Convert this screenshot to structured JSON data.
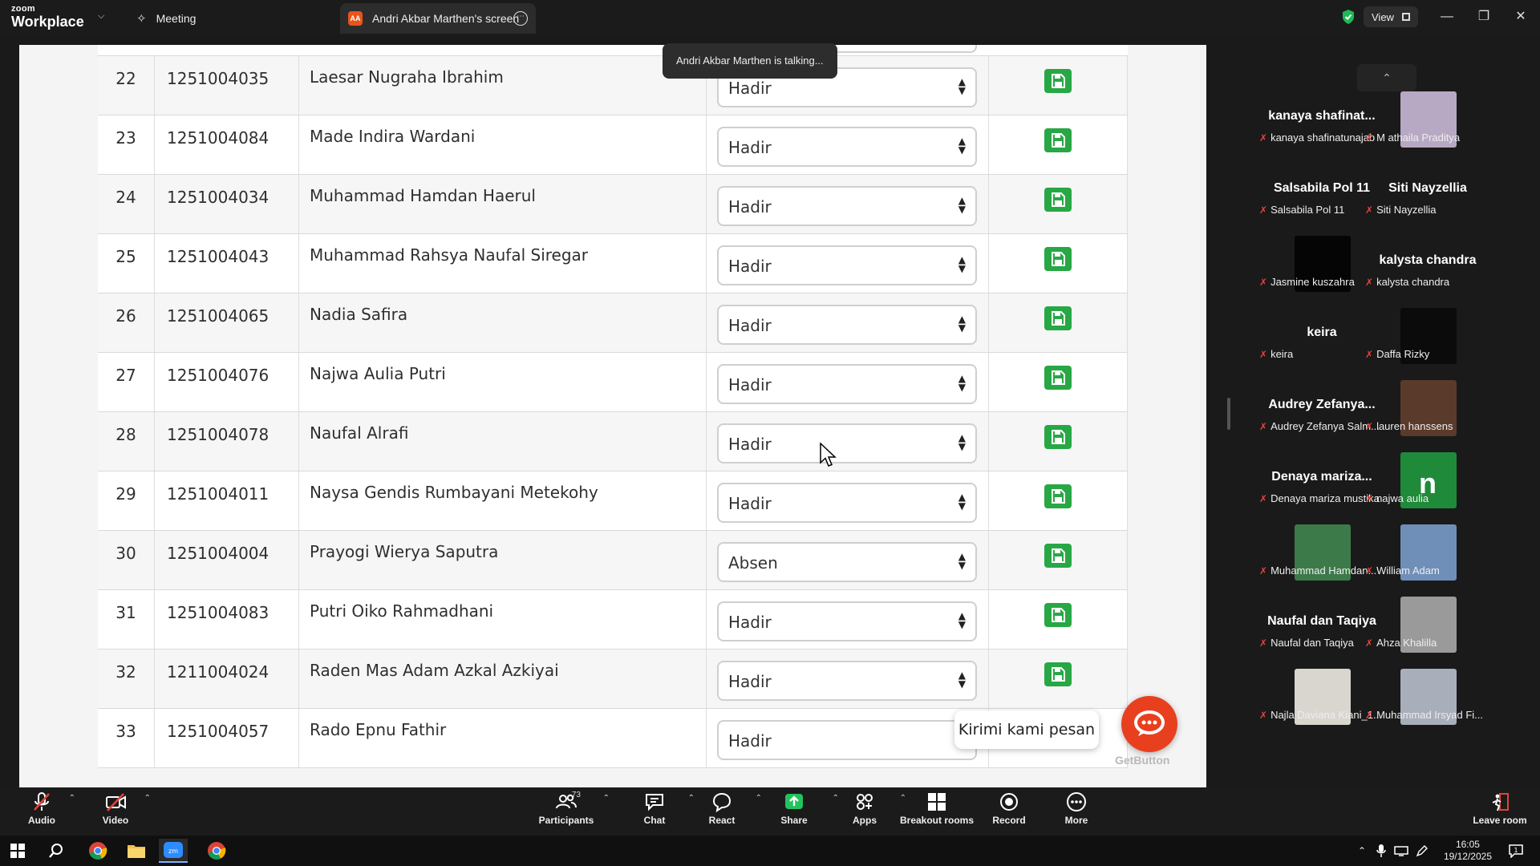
{
  "titlebar": {
    "logo_line1": "zoom",
    "logo_line2": "Workplace",
    "tab_meeting": "Meeting",
    "tab_share": "Andri Akbar Marthen's screen",
    "tab_share_badge": "AA",
    "view_label": "View"
  },
  "share": {
    "talking_indicator": "Andri Akbar Marthen is talking...",
    "chat_bubble": "Kirimi kami pesan",
    "getbutton_brand": "GetButton",
    "rows": [
      {
        "no": "22",
        "nim": "1251004035",
        "nama": "Laesar Nugraha Ibrahim",
        "status": "Hadir"
      },
      {
        "no": "23",
        "nim": "1251004084",
        "nama": "Made Indira Wardani",
        "status": "Hadir"
      },
      {
        "no": "24",
        "nim": "1251004034",
        "nama": "Muhammad Hamdan Haerul",
        "status": "Hadir"
      },
      {
        "no": "25",
        "nim": "1251004043",
        "nama": "Muhammad Rahsya Naufal Siregar",
        "status": "Hadir"
      },
      {
        "no": "26",
        "nim": "1251004065",
        "nama": "Nadia Safira",
        "status": "Hadir"
      },
      {
        "no": "27",
        "nim": "1251004076",
        "nama": "Najwa Aulia Putri",
        "status": "Hadir"
      },
      {
        "no": "28",
        "nim": "1251004078",
        "nama": "Naufal Alrafi",
        "status": "Hadir"
      },
      {
        "no": "29",
        "nim": "1251004011",
        "nama": "Naysa Gendis Rumbayani Metekohy",
        "status": "Hadir"
      },
      {
        "no": "30",
        "nim": "1251004004",
        "nama": "Prayogi Wierya Saputra",
        "status": "Absen"
      },
      {
        "no": "31",
        "nim": "1251004083",
        "nama": "Putri Oiko Rahmadhani",
        "status": "Hadir"
      },
      {
        "no": "32",
        "nim": "1211004024",
        "nama": "Raden Mas Adam Azkal Azkiyai",
        "status": "Hadir"
      },
      {
        "no": "33",
        "nim": "1251004057",
        "nama": "Rado Epnu Fathir",
        "status": "Hadir"
      }
    ]
  },
  "participants": [
    {
      "big": "kanaya  shafinat...",
      "label": "kanaya shafinatunajab",
      "thumb": "none"
    },
    {
      "big": "",
      "label": "M athaila Praditya",
      "thumb": "#b7a9c4"
    },
    {
      "big": "Salsabila Pol 11",
      "label": "Salsabila Pol 11",
      "thumb": "none"
    },
    {
      "big": "Siti Nayzellia",
      "label": "Siti Nayzellia",
      "thumb": "none"
    },
    {
      "big": "",
      "label": "Jasmine kuszahra",
      "thumb": "#050505"
    },
    {
      "big": "kalysta chandra",
      "label": "kalysta chandra",
      "thumb": "none"
    },
    {
      "big": "keira",
      "label": "keira",
      "thumb": "none"
    },
    {
      "big": "",
      "label": "Daffa Rizky",
      "thumb": "#0b0b0b"
    },
    {
      "big": "Audrey  Zefanya...",
      "label": "Audrey Zefanya Salm...",
      "thumb": "none"
    },
    {
      "big": "",
      "label": "lauren hanssens",
      "thumb": "#5a3a2a"
    },
    {
      "big": "Denaya  mariza...",
      "label": "Denaya mariza mustika",
      "thumb": "none"
    },
    {
      "big": "n",
      "label": "najwa aulia",
      "thumb": "#1f8a3a"
    },
    {
      "big": "",
      "label": "Muhammad Hamdan...",
      "thumb": "#3c7a4a"
    },
    {
      "big": "",
      "label": "William Adam",
      "thumb": "#6f8fb8"
    },
    {
      "big": "Naufal dan Taqiya",
      "label": "Naufal dan Taqiya",
      "thumb": "none"
    },
    {
      "big": "",
      "label": "Ahza Khalilla",
      "thumb": "#9a9a9a"
    },
    {
      "big": "",
      "label": "Najla Daviana Kiani_1...",
      "thumb": "#d9d5cf"
    },
    {
      "big": "",
      "label": "Muhammad Irsyad Fi...",
      "thumb": "#a9aebb"
    }
  ],
  "toolbar": {
    "audio": "Audio",
    "video": "Video",
    "participants": "Participants",
    "participants_count": "73",
    "chat": "Chat",
    "react": "React",
    "share": "Share",
    "apps": "Apps",
    "breakout": "Breakout rooms",
    "record": "Record",
    "more": "More",
    "leave": "Leave room"
  },
  "taskbar": {
    "time": "16:05",
    "date": "19/12/2025"
  },
  "colors": {
    "save_green": "#28a745",
    "accent_orange": "#e8541b",
    "share_green": "#22c35d",
    "mic_muted_red": "#e5433b"
  }
}
